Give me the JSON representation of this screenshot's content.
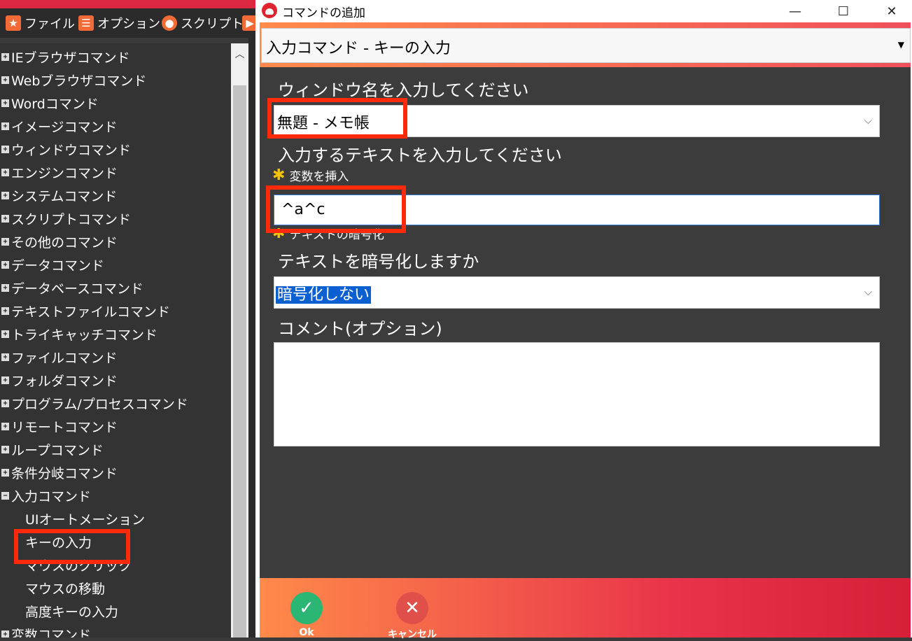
{
  "app": {
    "menu": [
      {
        "label": "ファイル",
        "icon": "star-icon"
      },
      {
        "label": "オプション",
        "icon": "menu-icon"
      },
      {
        "label": "スクリプト",
        "icon": "record-icon"
      }
    ],
    "tree": [
      {
        "label": "IEブラウザコマンド"
      },
      {
        "label": "Webブラウザコマンド"
      },
      {
        "label": "Wordコマンド"
      },
      {
        "label": "イメージコマンド"
      },
      {
        "label": "ウィンドウコマンド"
      },
      {
        "label": "エンジンコマンド"
      },
      {
        "label": "システムコマンド"
      },
      {
        "label": "スクリプトコマンド"
      },
      {
        "label": "その他のコマンド"
      },
      {
        "label": "データコマンド"
      },
      {
        "label": "データベースコマンド"
      },
      {
        "label": "テキストファイルコマンド"
      },
      {
        "label": "トライキャッチコマンド"
      },
      {
        "label": "ファイルコマンド"
      },
      {
        "label": "フォルダコマンド"
      },
      {
        "label": "プログラム/プロセスコマンド"
      },
      {
        "label": "リモートコマンド"
      },
      {
        "label": "ループコマンド"
      },
      {
        "label": "条件分岐コマンド"
      },
      {
        "label": "入力コマンド"
      }
    ],
    "tree_children": [
      {
        "label": "UIオートメーション"
      },
      {
        "label": "キーの入力"
      },
      {
        "label": "マウスのクリック"
      },
      {
        "label": "マウスの移動"
      },
      {
        "label": "高度キーの入力"
      }
    ],
    "tree_last": "変数コマンド"
  },
  "dialog": {
    "title": "コマンドの追加",
    "command": "入力コマンド - キーの入力",
    "window_label": "ウィンドウ名を入力してください",
    "window_value": "無題 - メモ帳",
    "text_label": "入力するテキストを入力してください",
    "insert_variable": "変数を挿入",
    "text_value": "^a^c",
    "encrypt_link": "テキストの暗号化",
    "encrypt_label": "テキストを暗号化しますか",
    "encrypt_value": "暗号化しない",
    "comment_label": "コメント(オプション)",
    "comment_value": "",
    "ok_label": "Ok",
    "cancel_label": "キャンセル"
  },
  "colors": {
    "accent": "#f0505a",
    "highlight_box": "#ff2a0a",
    "ok_green": "#2bb673",
    "cancel_red": "#e0504a"
  }
}
